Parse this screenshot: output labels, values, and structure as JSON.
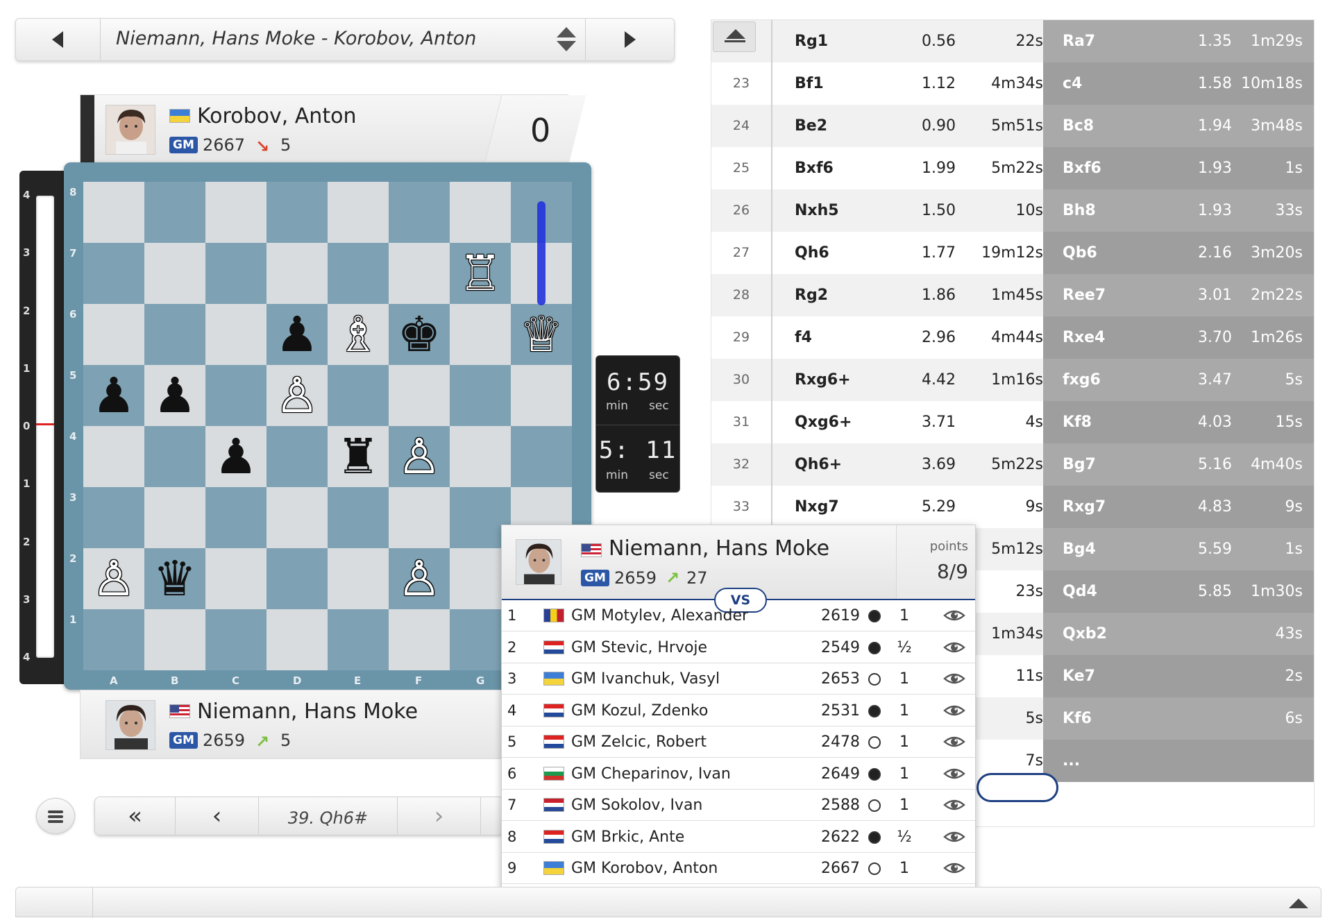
{
  "game_selector": {
    "title": "Niemann, Hans Moke - Korobov, Anton"
  },
  "top_player": {
    "name": "Korobov, Anton",
    "title": "GM",
    "rating": "2667",
    "rating_change": "5",
    "rating_direction": "down",
    "flag": "ukraine",
    "score": "0"
  },
  "bottom_player": {
    "name": "Niemann, Hans Moke",
    "title": "GM",
    "rating": "2659",
    "rating_change": "5",
    "rating_direction": "up",
    "flag": "usa"
  },
  "eval_bar": {
    "ticks": [
      "4",
      "3",
      "2",
      "1",
      "0",
      "1",
      "2",
      "3",
      "4"
    ],
    "evaluation": 0
  },
  "board": {
    "ranks": [
      "8",
      "7",
      "6",
      "5",
      "4",
      "3",
      "2",
      "1"
    ],
    "files": [
      "A",
      "B",
      "C",
      "D",
      "E",
      "F",
      "G"
    ],
    "pieces": [
      {
        "square": "g7",
        "type": "rook",
        "color": "white",
        "glyph": "♖"
      },
      {
        "square": "d6",
        "type": "pawn",
        "color": "black",
        "glyph": "♟"
      },
      {
        "square": "e6",
        "type": "bishop",
        "color": "white",
        "glyph": "♗"
      },
      {
        "square": "f6",
        "type": "king",
        "color": "black",
        "glyph": "♚"
      },
      {
        "square": "h6",
        "type": "queen",
        "color": "white",
        "glyph": "♕"
      },
      {
        "square": "a5",
        "type": "pawn",
        "color": "black",
        "glyph": "♟"
      },
      {
        "square": "b5",
        "type": "pawn",
        "color": "black",
        "glyph": "♟"
      },
      {
        "square": "d5",
        "type": "pawn",
        "color": "white",
        "glyph": "♙"
      },
      {
        "square": "c4",
        "type": "pawn",
        "color": "black",
        "glyph": "♟"
      },
      {
        "square": "e4",
        "type": "rook",
        "color": "black",
        "glyph": "♜"
      },
      {
        "square": "f4",
        "type": "pawn",
        "color": "white",
        "glyph": "♙"
      },
      {
        "square": "a2",
        "type": "pawn",
        "color": "white",
        "glyph": "♙"
      },
      {
        "square": "b2",
        "type": "queen",
        "color": "black",
        "glyph": "♛"
      },
      {
        "square": "f2",
        "type": "pawn",
        "color": "white",
        "glyph": "♙"
      }
    ],
    "arrow_color": "#2233dd"
  },
  "clock": {
    "top": {
      "time": "6:59",
      "min_label": "min",
      "sec_label": "sec"
    },
    "bottom": {
      "time": "5: 11",
      "min_label": "min",
      "sec_label": "sec"
    }
  },
  "move_nav": {
    "current_move": "39. Qh6#"
  },
  "moves": [
    {
      "n": "22",
      "w": "Rg1",
      "we": "0.56",
      "wt": "22s",
      "b": "Ra7",
      "be": "1.35",
      "bt": "1m29s"
    },
    {
      "n": "23",
      "w": "Bf1",
      "we": "1.12",
      "wt": "4m34s",
      "b": "c4",
      "be": "1.58",
      "bt": "10m18s"
    },
    {
      "n": "24",
      "w": "Be2",
      "we": "0.90",
      "wt": "5m51s",
      "b": "Bc8",
      "be": "1.94",
      "bt": "3m48s"
    },
    {
      "n": "25",
      "w": "Bxf6",
      "we": "1.99",
      "wt": "5m22s",
      "b": "Bxf6",
      "be": "1.93",
      "bt": "1s"
    },
    {
      "n": "26",
      "w": "Nxh5",
      "we": "1.50",
      "wt": "10s",
      "b": "Bh8",
      "be": "1.93",
      "bt": "33s"
    },
    {
      "n": "27",
      "w": "Qh6",
      "we": "1.77",
      "wt": "19m12s",
      "b": "Qb6",
      "be": "2.16",
      "bt": "3m20s"
    },
    {
      "n": "28",
      "w": "Rg2",
      "we": "1.86",
      "wt": "1m45s",
      "b": "Ree7",
      "be": "3.01",
      "bt": "2m22s"
    },
    {
      "n": "29",
      "w": "f4",
      "we": "2.96",
      "wt": "4m44s",
      "b": "Rxe4",
      "be": "3.70",
      "bt": "1m26s"
    },
    {
      "n": "30",
      "w": "Rxg6+",
      "we": "4.42",
      "wt": "1m16s",
      "b": "fxg6",
      "be": "3.47",
      "bt": "5s"
    },
    {
      "n": "31",
      "w": "Qxg6+",
      "we": "3.71",
      "wt": "4s",
      "b": "Kf8",
      "be": "4.03",
      "bt": "15s"
    },
    {
      "n": "32",
      "w": "Qh6+",
      "we": "3.69",
      "wt": "5m22s",
      "b": "Bg7",
      "be": "5.16",
      "bt": "4m40s"
    },
    {
      "n": "33",
      "w": "Nxg7",
      "we": "5.29",
      "wt": "9s",
      "b": "Rxg7",
      "be": "4.83",
      "bt": "9s"
    },
    {
      "n": "",
      "w": "",
      "we": "",
      "wt": "5m12s",
      "b": "Bg4",
      "be": "5.59",
      "bt": "1s"
    },
    {
      "n": "",
      "w": "",
      "we": "",
      "wt": "23s",
      "b": "Qd4",
      "be": "5.85",
      "bt": "1m30s"
    },
    {
      "n": "",
      "w": "",
      "we": "",
      "wt": "1m34s",
      "b": "Qxb2",
      "be": "",
      "bt": "43s"
    },
    {
      "n": "",
      "w": "",
      "we": "",
      "wt": "11s",
      "b": "Ke7",
      "be": "",
      "bt": "2s"
    },
    {
      "n": "",
      "w": "",
      "we": "",
      "wt": "5s",
      "b": "Kf6",
      "be": "",
      "bt": "6s"
    },
    {
      "n": "",
      "w": "",
      "we": "",
      "wt": "7s",
      "b": "...",
      "be": "",
      "bt": ""
    }
  ],
  "popup": {
    "player_name": "Niemann, Hans Moke",
    "title": "GM",
    "rating": "2659",
    "rating_change": "27",
    "rating_direction": "up",
    "points_label": "points",
    "points": "8/9",
    "vs_label": "VS",
    "rounds": [
      {
        "n": "1",
        "flag": "ro",
        "opponent": "GM Motylev, Alexander",
        "rating": "2619",
        "color": "black",
        "result": "1"
      },
      {
        "n": "2",
        "flag": "hr",
        "opponent": "GM Stevic, Hrvoje",
        "rating": "2549",
        "color": "black",
        "result": "½"
      },
      {
        "n": "3",
        "flag": "ua",
        "opponent": "GM Ivanchuk, Vasyl",
        "rating": "2653",
        "color": "white",
        "result": "1"
      },
      {
        "n": "4",
        "flag": "hr",
        "opponent": "GM Kozul, Zdenko",
        "rating": "2531",
        "color": "black",
        "result": "1"
      },
      {
        "n": "5",
        "flag": "hr",
        "opponent": "GM Zelcic, Robert",
        "rating": "2478",
        "color": "white",
        "result": "1"
      },
      {
        "n": "6",
        "flag": "bg",
        "opponent": "GM Cheparinov, Ivan",
        "rating": "2649",
        "color": "black",
        "result": "1"
      },
      {
        "n": "7",
        "flag": "nl",
        "opponent": "GM Sokolov, Ivan",
        "rating": "2588",
        "color": "white",
        "result": "1"
      },
      {
        "n": "8",
        "flag": "hr",
        "opponent": "GM Brkic, Ante",
        "rating": "2622",
        "color": "black",
        "result": "½"
      },
      {
        "n": "9",
        "flag": "ua",
        "opponent": "GM Korobov, Anton",
        "rating": "2667",
        "color": "white",
        "result": "1"
      }
    ]
  },
  "colors": {
    "accent": "#1d3f82",
    "gm_badge": "#2b57a6",
    "rating_up": "#7bc043",
    "rating_down": "#d9432c",
    "board_light": "#d8dcde",
    "board_dark": "#7ea2b4"
  }
}
